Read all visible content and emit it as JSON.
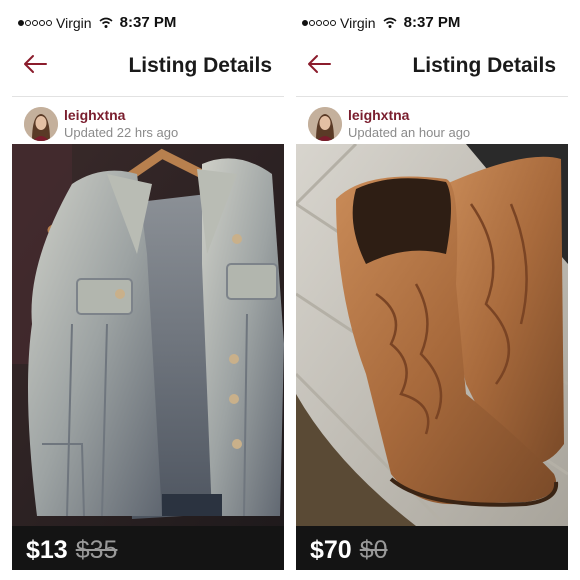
{
  "colors": {
    "accent": "#8b1c2c",
    "price_bar": "#141414",
    "username": "#7a1e2e"
  },
  "panels": [
    {
      "status": {
        "carrier": "Virgin",
        "time": "8:37 PM"
      },
      "nav": {
        "title": "Listing Details",
        "back_icon": "arrow-left-icon"
      },
      "user": {
        "name": "leighxtna",
        "updated": "Updated 22 hrs ago"
      },
      "item": {
        "price": "$13",
        "original_price": "$35",
        "photo": "denim vest"
      }
    },
    {
      "status": {
        "carrier": "Virgin",
        "time": "8:37 PM"
      },
      "nav": {
        "title": "Listing Details",
        "back_icon": "arrow-left-icon"
      },
      "user": {
        "name": "leighxtna",
        "updated": "Updated an hour ago"
      },
      "item": {
        "price": "$70",
        "original_price": "$0",
        "photo": "brown cowboy boots"
      }
    }
  ]
}
